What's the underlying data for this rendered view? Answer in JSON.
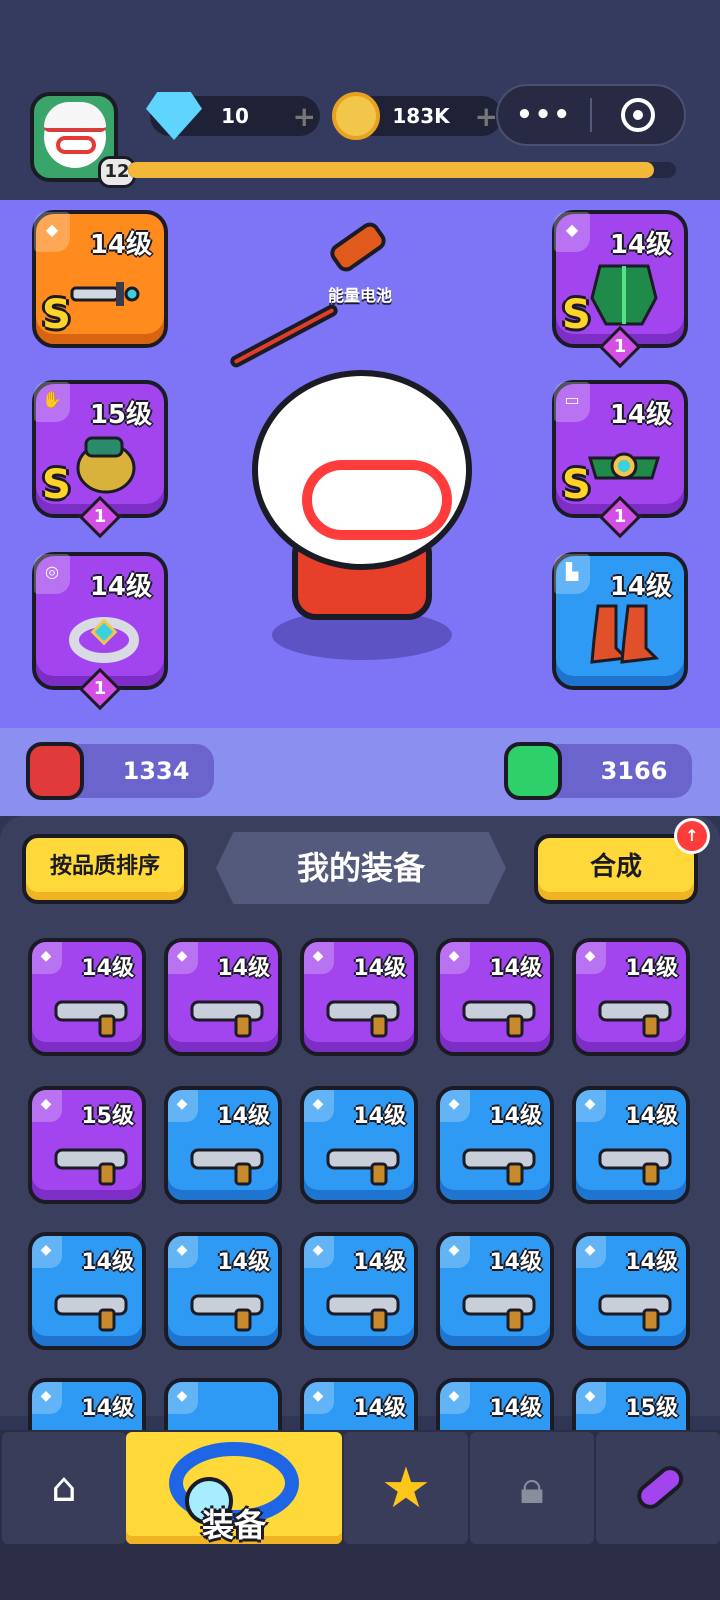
{
  "header": {
    "player_level": "12",
    "xp_progress": 0.96,
    "gems": "10",
    "coins": "183K",
    "plus_symbol": "+",
    "menu_dots": "•••"
  },
  "stage": {
    "battery_label": "能量电池",
    "equipped": [
      {
        "slot": "weapon",
        "level": "14级",
        "rarity": "S",
        "color": "orange",
        "stars": ""
      },
      {
        "slot": "armor",
        "level": "14级",
        "rarity": "S",
        "color": "purple",
        "stars": "1"
      },
      {
        "slot": "gloves",
        "level": "15级",
        "rarity": "S",
        "color": "purple",
        "stars": "1"
      },
      {
        "slot": "belt",
        "level": "14级",
        "rarity": "S",
        "color": "purple",
        "stars": "1"
      },
      {
        "slot": "ring",
        "level": "14级",
        "rarity": "",
        "color": "purple",
        "stars": "1"
      },
      {
        "slot": "boots",
        "level": "14级",
        "rarity": "",
        "color": "blue",
        "stars": ""
      }
    ],
    "attack": "1334",
    "health": "3166"
  },
  "panel": {
    "sort_label": "按品质排序",
    "title": "我的装备",
    "merge_label": "合成"
  },
  "inventory": [
    {
      "level": "14级",
      "color": "purple"
    },
    {
      "level": "14级",
      "color": "purple"
    },
    {
      "level": "14级",
      "color": "purple"
    },
    {
      "level": "14级",
      "color": "purple"
    },
    {
      "level": "14级",
      "color": "purple"
    },
    {
      "level": "15级",
      "color": "purple"
    },
    {
      "level": "14级",
      "color": "blue"
    },
    {
      "level": "14级",
      "color": "blue"
    },
    {
      "level": "14级",
      "color": "blue"
    },
    {
      "level": "14级",
      "color": "blue"
    },
    {
      "level": "14级",
      "color": "blue"
    },
    {
      "level": "14级",
      "color": "blue"
    },
    {
      "level": "14级",
      "color": "blue"
    },
    {
      "level": "14级",
      "color": "blue"
    },
    {
      "level": "14级",
      "color": "blue"
    },
    {
      "level": "14级",
      "color": "blue"
    },
    {
      "level": "",
      "color": "blue"
    },
    {
      "level": "14级",
      "color": "blue"
    },
    {
      "level": "14级",
      "color": "blue"
    },
    {
      "level": "15级",
      "color": "blue"
    }
  ],
  "nav": {
    "active_label": "装备"
  }
}
